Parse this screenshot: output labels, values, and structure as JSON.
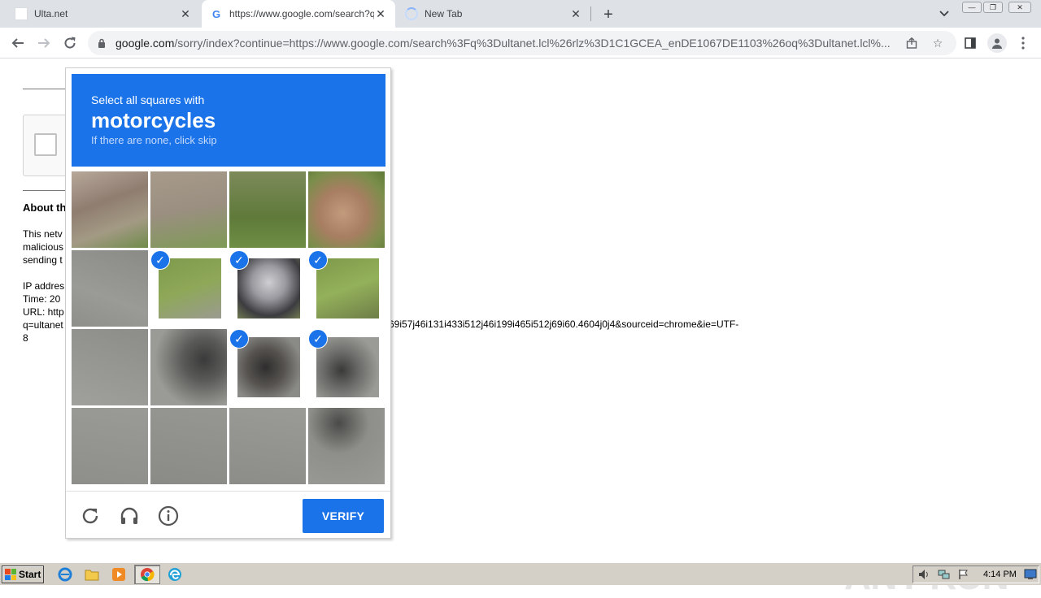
{
  "browser": {
    "tabs": [
      {
        "title": "Ulta.net",
        "active": false
      },
      {
        "title": "https://www.google.com/search?q=",
        "active": true
      },
      {
        "title": "New Tab",
        "active": false
      }
    ],
    "url_host": "google.com",
    "url_path": "/sorry/index?continue=https://www.google.com/search%3Fq%3Dultanet.lcl%26rlz%3D1C1GCEA_enDE1067DE1103%26oq%3Dultanet.lcl%..."
  },
  "page": {
    "about_heading": "About th",
    "para1": [
      "This netv",
      "malicious",
      "sending t"
    ],
    "info": [
      "IP addres",
      "Time: 20",
      "URL: http",
      "q=ultanet",
      "8"
    ],
    "url_tail": "69i57j46i131i433i512j46i199i465i512j69i60.4604j0j4&sourceid=chrome&ie=UTF-"
  },
  "recaptcha": {
    "instruction": "Select all squares with",
    "object": "motorcycles",
    "skip_hint": "If there are none, click skip",
    "verify_label": "VERIFY",
    "selected_tiles": [
      5,
      6,
      7,
      10,
      11
    ],
    "accent_color": "#1a73e8"
  },
  "watermark": "ANY RUN",
  "taskbar": {
    "start_label": "Start",
    "clock": "4:14 PM"
  }
}
